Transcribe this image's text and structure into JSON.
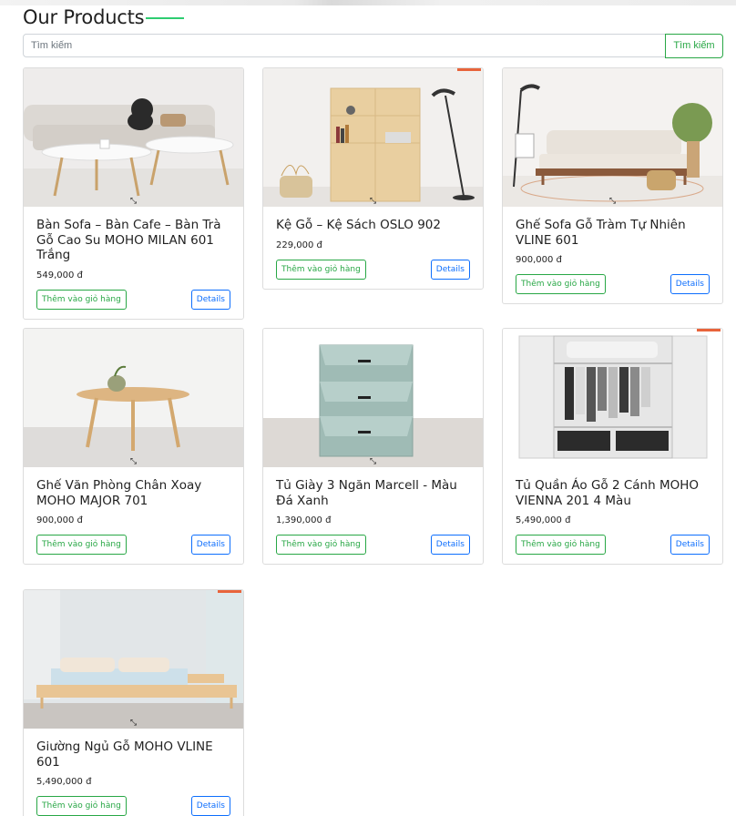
{
  "header": {
    "title": "Our Products"
  },
  "search": {
    "placeholder": "Tìm kiếm",
    "value": "",
    "button_label": "Tìm kiếm"
  },
  "colors": {
    "accent_green": "#28a745",
    "accent_blue": "#0d6efd",
    "title_underline": "#2ecc71"
  },
  "products": [
    {
      "name": "Bàn Sofa – Bàn Cafe – Bàn Trà Gỗ Cao Su MOHO MILAN 601 Trắng",
      "price": "549,000 đ",
      "cart_label": "Thêm vào giỏ hàng",
      "details_label": "Details",
      "image_icon": "coffee-table-image"
    },
    {
      "name": "Kệ Gỗ – Kệ Sách OSLO 902",
      "price": "229,000 đ",
      "cart_label": "Thêm vào giỏ hàng",
      "details_label": "Details",
      "image_icon": "bookshelf-image"
    },
    {
      "name": "Ghế Sofa Gỗ Tràm Tự Nhiên VLINE 601",
      "price": "900,000 đ",
      "cart_label": "Thêm vào giỏ hàng",
      "details_label": "Details",
      "image_icon": "sofa-image"
    },
    {
      "name": "Ghế Văn Phòng Chân Xoay MOHO MAJOR 701",
      "price": "900,000 đ",
      "cart_label": "Thêm vào giỏ hàng",
      "details_label": "Details",
      "image_icon": "round-table-image"
    },
    {
      "name": "Tủ Giày 3 Ngăn Marcell - Màu Đá Xanh",
      "price": "1,390,000 đ",
      "cart_label": "Thêm vào giỏ hàng",
      "details_label": "Details",
      "image_icon": "shoe-cabinet-image"
    },
    {
      "name": "Tủ Quần Áo Gỗ 2 Cánh MOHO VIENNA 201 4 Màu",
      "price": "5,490,000 đ",
      "cart_label": "Thêm vào giỏ hàng",
      "details_label": "Details",
      "image_icon": "wardrobe-image"
    },
    {
      "name": "Giường Ngủ Gỗ MOHO VLINE 601",
      "price": "5,490,000 đ",
      "cart_label": "Thêm vào giỏ hàng",
      "details_label": "Details",
      "image_icon": "bed-image"
    }
  ]
}
